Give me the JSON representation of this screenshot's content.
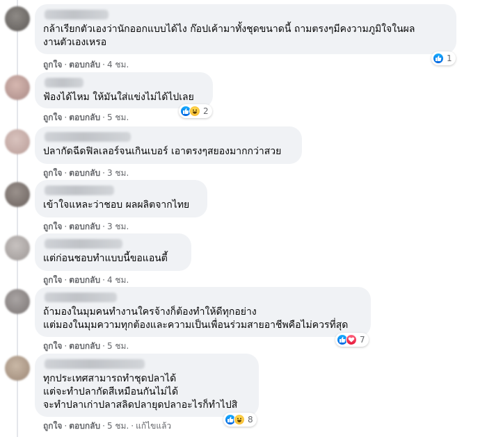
{
  "actions": {
    "like": "ถูกใจ",
    "reply": "ตอบกลับ",
    "separator": "·",
    "edited": "แก้ไขแล้ว"
  },
  "colors": {
    "bubble": "#f0f2f5",
    "secondary_text": "#65676b",
    "like_blue": "#1877f2"
  },
  "comments": [
    {
      "text": "กล้าเรียกตัวเองว่านักออกแบบได้ไง ก๊อปเค้ามาทั้งชุดขนาดนี้ ถามตรงๆมีคงวามภูมิใจในผล\nงานตัวเองเหรอ",
      "time": "4 ชม.",
      "reaction_count": "1",
      "reaction_icons": [
        "like-icon"
      ]
    },
    {
      "text": "ฟ้องได้ไหม ให้มันใส่แข่งไม่ได้ไปเลย",
      "time": "5 ชม.",
      "reaction_count": "2",
      "reaction_icons": [
        "like-icon",
        "haha-icon"
      ]
    },
    {
      "text": "ปลากัดฉีดฟิลเลอร์จนเกินเบอร์ เอาตรงๆสยองมากกว่าสวย",
      "time": "3 ชม."
    },
    {
      "text": "เข้าใจแหละว่าชอบ ผลผลิตจากไทย",
      "time": "3 ชม."
    },
    {
      "text": "แต่ก่อนชอบทำแบบนี้ขอแอนตี้",
      "time": "4 ชม."
    },
    {
      "text": "ถ้ามองในมุมคนทำงานใครจ้างก็ต้องทำให้ดีทุกอย่าง\nแต่มองในมุมความทุกต้องและความเป็นเพื่อนร่วมสายอาชีพคือไม่ควรที่สุด",
      "time": "5 ชม.",
      "reaction_count": "7",
      "reaction_icons": [
        "like-icon",
        "love-icon"
      ]
    },
    {
      "text": "ทุกประเทศสามารถทำชุดปลาได้\nแต่จะทำปลากัดสีเหมือนกันไม่ได้\nจะทำปลาเก่าปลาสลิดปลายุดปลาอะไรก็ทำไปสิ",
      "time": "5 ชม.",
      "reaction_count": "8",
      "reaction_icons": [
        "like-icon",
        "haha-icon"
      ]
    }
  ]
}
